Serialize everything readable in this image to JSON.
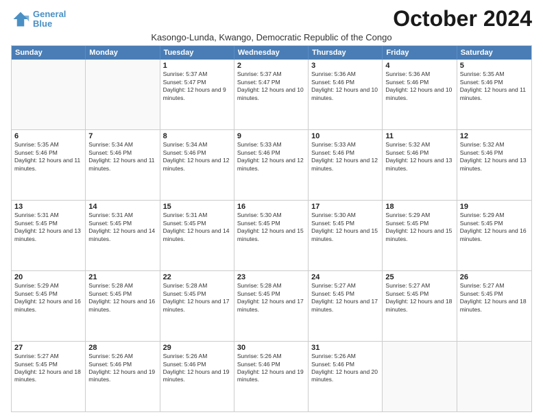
{
  "logo": {
    "line1": "General",
    "line2": "Blue"
  },
  "title": "October 2024",
  "subtitle": "Kasongo-Lunda, Kwango, Democratic Republic of the Congo",
  "header_days": [
    "Sunday",
    "Monday",
    "Tuesday",
    "Wednesday",
    "Thursday",
    "Friday",
    "Saturday"
  ],
  "rows": [
    [
      {
        "day": "",
        "info": ""
      },
      {
        "day": "",
        "info": ""
      },
      {
        "day": "1",
        "info": "Sunrise: 5:37 AM\nSunset: 5:47 PM\nDaylight: 12 hours and 9 minutes."
      },
      {
        "day": "2",
        "info": "Sunrise: 5:37 AM\nSunset: 5:47 PM\nDaylight: 12 hours and 10 minutes."
      },
      {
        "day": "3",
        "info": "Sunrise: 5:36 AM\nSunset: 5:46 PM\nDaylight: 12 hours and 10 minutes."
      },
      {
        "day": "4",
        "info": "Sunrise: 5:36 AM\nSunset: 5:46 PM\nDaylight: 12 hours and 10 minutes."
      },
      {
        "day": "5",
        "info": "Sunrise: 5:35 AM\nSunset: 5:46 PM\nDaylight: 12 hours and 11 minutes."
      }
    ],
    [
      {
        "day": "6",
        "info": "Sunrise: 5:35 AM\nSunset: 5:46 PM\nDaylight: 12 hours and 11 minutes."
      },
      {
        "day": "7",
        "info": "Sunrise: 5:34 AM\nSunset: 5:46 PM\nDaylight: 12 hours and 11 minutes."
      },
      {
        "day": "8",
        "info": "Sunrise: 5:34 AM\nSunset: 5:46 PM\nDaylight: 12 hours and 12 minutes."
      },
      {
        "day": "9",
        "info": "Sunrise: 5:33 AM\nSunset: 5:46 PM\nDaylight: 12 hours and 12 minutes."
      },
      {
        "day": "10",
        "info": "Sunrise: 5:33 AM\nSunset: 5:46 PM\nDaylight: 12 hours and 12 minutes."
      },
      {
        "day": "11",
        "info": "Sunrise: 5:32 AM\nSunset: 5:46 PM\nDaylight: 12 hours and 13 minutes."
      },
      {
        "day": "12",
        "info": "Sunrise: 5:32 AM\nSunset: 5:46 PM\nDaylight: 12 hours and 13 minutes."
      }
    ],
    [
      {
        "day": "13",
        "info": "Sunrise: 5:31 AM\nSunset: 5:45 PM\nDaylight: 12 hours and 13 minutes."
      },
      {
        "day": "14",
        "info": "Sunrise: 5:31 AM\nSunset: 5:45 PM\nDaylight: 12 hours and 14 minutes."
      },
      {
        "day": "15",
        "info": "Sunrise: 5:31 AM\nSunset: 5:45 PM\nDaylight: 12 hours and 14 minutes."
      },
      {
        "day": "16",
        "info": "Sunrise: 5:30 AM\nSunset: 5:45 PM\nDaylight: 12 hours and 15 minutes."
      },
      {
        "day": "17",
        "info": "Sunrise: 5:30 AM\nSunset: 5:45 PM\nDaylight: 12 hours and 15 minutes."
      },
      {
        "day": "18",
        "info": "Sunrise: 5:29 AM\nSunset: 5:45 PM\nDaylight: 12 hours and 15 minutes."
      },
      {
        "day": "19",
        "info": "Sunrise: 5:29 AM\nSunset: 5:45 PM\nDaylight: 12 hours and 16 minutes."
      }
    ],
    [
      {
        "day": "20",
        "info": "Sunrise: 5:29 AM\nSunset: 5:45 PM\nDaylight: 12 hours and 16 minutes."
      },
      {
        "day": "21",
        "info": "Sunrise: 5:28 AM\nSunset: 5:45 PM\nDaylight: 12 hours and 16 minutes."
      },
      {
        "day": "22",
        "info": "Sunrise: 5:28 AM\nSunset: 5:45 PM\nDaylight: 12 hours and 17 minutes."
      },
      {
        "day": "23",
        "info": "Sunrise: 5:28 AM\nSunset: 5:45 PM\nDaylight: 12 hours and 17 minutes."
      },
      {
        "day": "24",
        "info": "Sunrise: 5:27 AM\nSunset: 5:45 PM\nDaylight: 12 hours and 17 minutes."
      },
      {
        "day": "25",
        "info": "Sunrise: 5:27 AM\nSunset: 5:45 PM\nDaylight: 12 hours and 18 minutes."
      },
      {
        "day": "26",
        "info": "Sunrise: 5:27 AM\nSunset: 5:45 PM\nDaylight: 12 hours and 18 minutes."
      }
    ],
    [
      {
        "day": "27",
        "info": "Sunrise: 5:27 AM\nSunset: 5:45 PM\nDaylight: 12 hours and 18 minutes."
      },
      {
        "day": "28",
        "info": "Sunrise: 5:26 AM\nSunset: 5:46 PM\nDaylight: 12 hours and 19 minutes."
      },
      {
        "day": "29",
        "info": "Sunrise: 5:26 AM\nSunset: 5:46 PM\nDaylight: 12 hours and 19 minutes."
      },
      {
        "day": "30",
        "info": "Sunrise: 5:26 AM\nSunset: 5:46 PM\nDaylight: 12 hours and 19 minutes."
      },
      {
        "day": "31",
        "info": "Sunrise: 5:26 AM\nSunset: 5:46 PM\nDaylight: 12 hours and 20 minutes."
      },
      {
        "day": "",
        "info": ""
      },
      {
        "day": "",
        "info": ""
      }
    ]
  ]
}
